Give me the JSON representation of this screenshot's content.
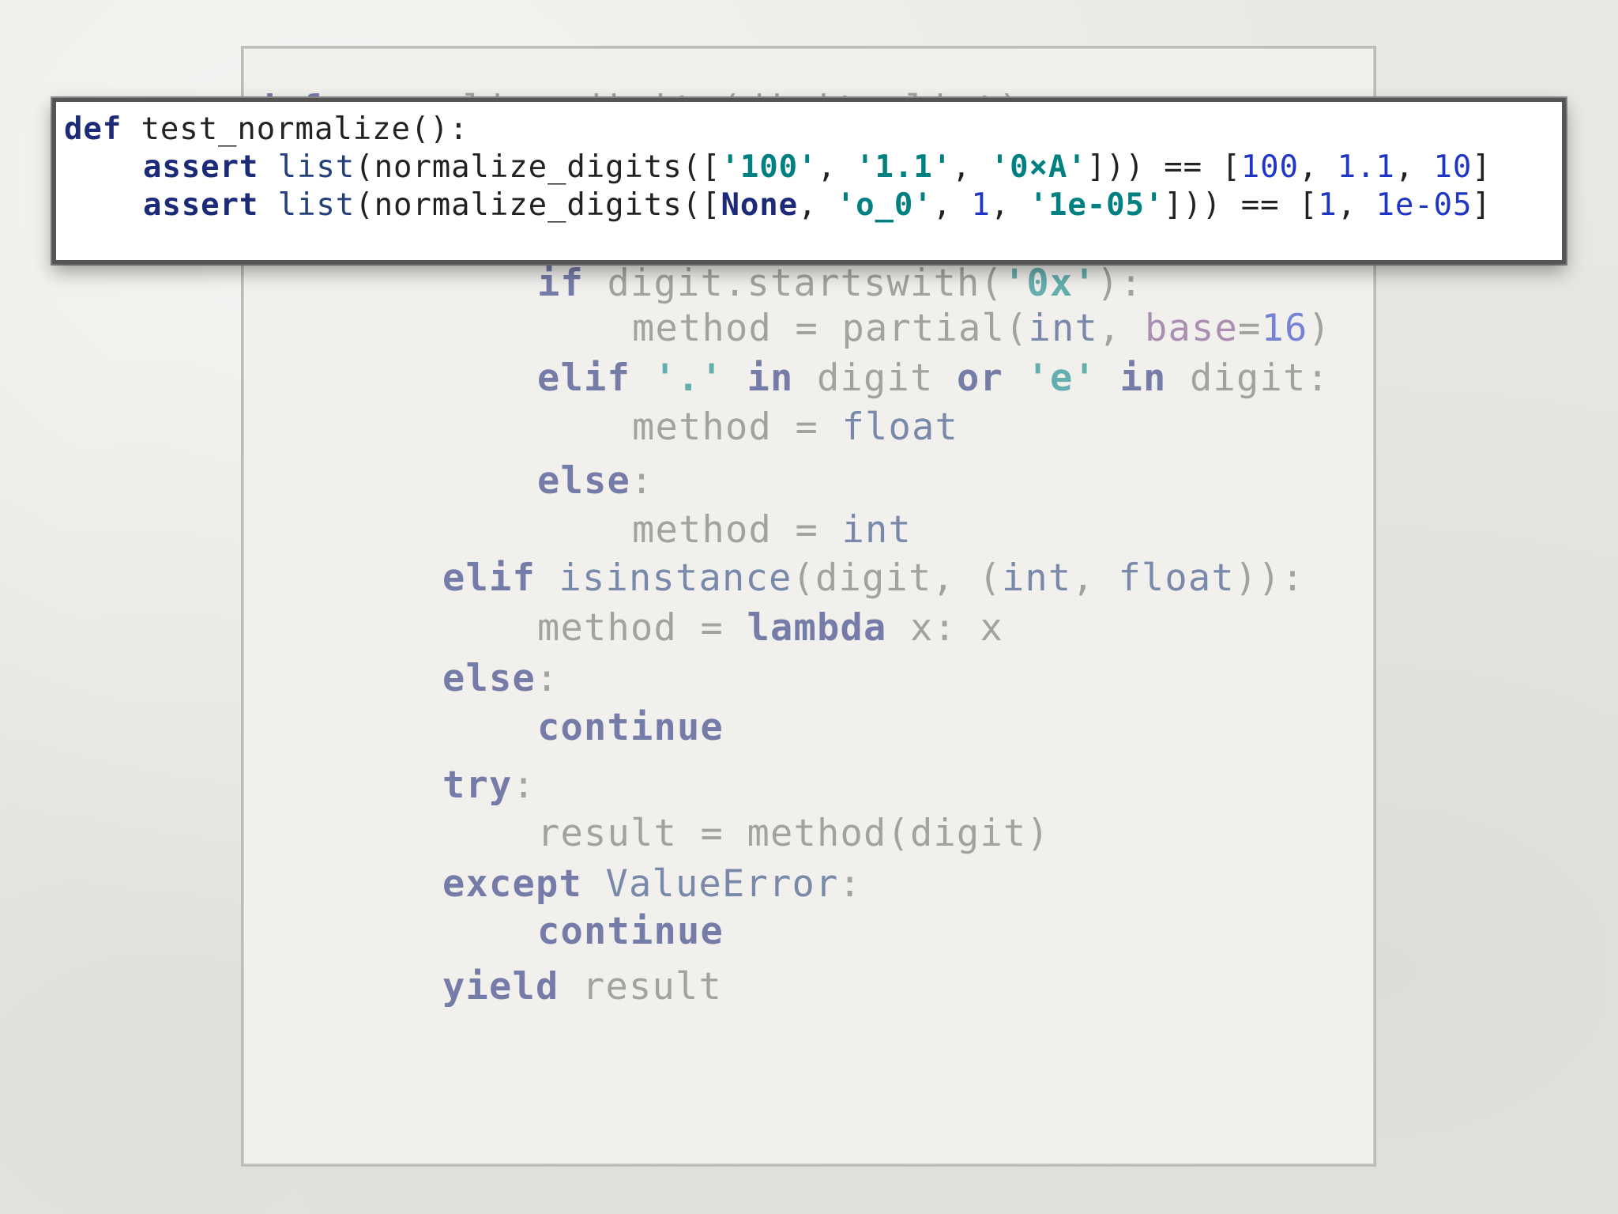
{
  "background_code": {
    "lines": [
      {
        "indent": 0,
        "tokens": [
          {
            "t": "def",
            "c": "kw"
          },
          {
            "t": " normalize_digits(digits_list):",
            "c": "plain"
          }
        ]
      },
      {
        "indent": 3,
        "tokens": [
          {
            "t": "if",
            "c": "kw"
          },
          {
            "t": " digit.startswith(",
            "c": "plain"
          },
          {
            "t": "'0x'",
            "c": "st"
          },
          {
            "t": "):",
            "c": "plain"
          }
        ]
      },
      {
        "indent": 4,
        "tokens": [
          {
            "t": "method = ",
            "c": "plain"
          },
          {
            "t": "partial",
            "c": "plain"
          },
          {
            "t": "(",
            "c": "plain"
          },
          {
            "t": "int",
            "c": "bi"
          },
          {
            "t": ", ",
            "c": "plain"
          },
          {
            "t": "base",
            "c": "kp"
          },
          {
            "t": "=",
            "c": "plain"
          },
          {
            "t": "16",
            "c": "nm"
          },
          {
            "t": ")",
            "c": "plain"
          }
        ]
      },
      {
        "indent": 3,
        "tokens": [
          {
            "t": "elif",
            "c": "kw"
          },
          {
            "t": " ",
            "c": "plain"
          },
          {
            "t": "'.'",
            "c": "st"
          },
          {
            "t": " ",
            "c": "plain"
          },
          {
            "t": "in",
            "c": "kw"
          },
          {
            "t": " digit ",
            "c": "plain"
          },
          {
            "t": "or",
            "c": "kw"
          },
          {
            "t": " ",
            "c": "plain"
          },
          {
            "t": "'e'",
            "c": "st"
          },
          {
            "t": " ",
            "c": "plain"
          },
          {
            "t": "in",
            "c": "kw"
          },
          {
            "t": " digit:",
            "c": "plain"
          }
        ]
      },
      {
        "indent": 4,
        "tokens": [
          {
            "t": "method = ",
            "c": "plain"
          },
          {
            "t": "float",
            "c": "bi"
          }
        ]
      },
      {
        "indent": 3,
        "tokens": [
          {
            "t": "else",
            "c": "kw"
          },
          {
            "t": ":",
            "c": "plain"
          }
        ]
      },
      {
        "indent": 4,
        "tokens": [
          {
            "t": "method = ",
            "c": "plain"
          },
          {
            "t": "int",
            "c": "bi"
          }
        ]
      },
      {
        "indent": 2,
        "tokens": [
          {
            "t": "elif",
            "c": "kw"
          },
          {
            "t": " ",
            "c": "plain"
          },
          {
            "t": "isinstance",
            "c": "bi"
          },
          {
            "t": "(digit, (",
            "c": "plain"
          },
          {
            "t": "int",
            "c": "bi"
          },
          {
            "t": ", ",
            "c": "plain"
          },
          {
            "t": "float",
            "c": "bi"
          },
          {
            "t": ")):",
            "c": "plain"
          }
        ]
      },
      {
        "indent": 3,
        "tokens": [
          {
            "t": "method = ",
            "c": "plain"
          },
          {
            "t": "lambda",
            "c": "kw"
          },
          {
            "t": " x: x",
            "c": "plain"
          }
        ]
      },
      {
        "indent": 2,
        "tokens": [
          {
            "t": "else",
            "c": "kw"
          },
          {
            "t": ":",
            "c": "plain"
          }
        ]
      },
      {
        "indent": 3,
        "tokens": [
          {
            "t": "continue",
            "c": "kw"
          }
        ]
      },
      {
        "indent": 2,
        "tokens": [
          {
            "t": "try",
            "c": "kw"
          },
          {
            "t": ":",
            "c": "plain"
          }
        ]
      },
      {
        "indent": 3,
        "tokens": [
          {
            "t": "result = method(digit)",
            "c": "plain"
          }
        ]
      },
      {
        "indent": 2,
        "tokens": [
          {
            "t": "except",
            "c": "kw"
          },
          {
            "t": " ",
            "c": "plain"
          },
          {
            "t": "ValueError",
            "c": "bi"
          },
          {
            "t": ":",
            "c": "plain"
          }
        ]
      },
      {
        "indent": 3,
        "tokens": [
          {
            "t": "continue",
            "c": "kw"
          }
        ]
      },
      {
        "indent": 2,
        "tokens": [
          {
            "t": "yield",
            "c": "kw"
          },
          {
            "t": " result",
            "c": "plain"
          }
        ]
      }
    ]
  },
  "foreground_code": {
    "lines": [
      {
        "indent": 0,
        "tokens": [
          {
            "t": "def",
            "c": "kw"
          },
          {
            "t": " test_normalize():",
            "c": "plain"
          }
        ]
      },
      {
        "indent": 1,
        "tokens": [
          {
            "t": "assert",
            "c": "kw"
          },
          {
            "t": " ",
            "c": "plain"
          },
          {
            "t": "list",
            "c": "bi"
          },
          {
            "t": "(normalize_digits([",
            "c": "plain"
          },
          {
            "t": "'100'",
            "c": "st"
          },
          {
            "t": ", ",
            "c": "plain"
          },
          {
            "t": "'1.1'",
            "c": "st"
          },
          {
            "t": ", ",
            "c": "plain"
          },
          {
            "t": "'0×A'",
            "c": "st"
          },
          {
            "t": "])) == [",
            "c": "plain"
          },
          {
            "t": "100",
            "c": "nm"
          },
          {
            "t": ", ",
            "c": "plain"
          },
          {
            "t": "1.1",
            "c": "nm"
          },
          {
            "t": ", ",
            "c": "plain"
          },
          {
            "t": "10",
            "c": "nm"
          },
          {
            "t": "]",
            "c": "plain"
          }
        ]
      },
      {
        "indent": 1,
        "tokens": [
          {
            "t": "assert",
            "c": "kw"
          },
          {
            "t": " ",
            "c": "plain"
          },
          {
            "t": "list",
            "c": "bi"
          },
          {
            "t": "(normalize_digits([",
            "c": "plain"
          },
          {
            "t": "None",
            "c": "kw"
          },
          {
            "t": ", ",
            "c": "plain"
          },
          {
            "t": "'o_0'",
            "c": "st"
          },
          {
            "t": ", ",
            "c": "plain"
          },
          {
            "t": "1",
            "c": "nm"
          },
          {
            "t": ", ",
            "c": "plain"
          },
          {
            "t": "'1e-05'",
            "c": "st"
          },
          {
            "t": "])) == [",
            "c": "plain"
          },
          {
            "t": "1",
            "c": "nm"
          },
          {
            "t": ", ",
            "c": "plain"
          },
          {
            "t": "1e-05",
            "c": "nm"
          },
          {
            "t": "]",
            "c": "plain"
          }
        ]
      }
    ]
  }
}
